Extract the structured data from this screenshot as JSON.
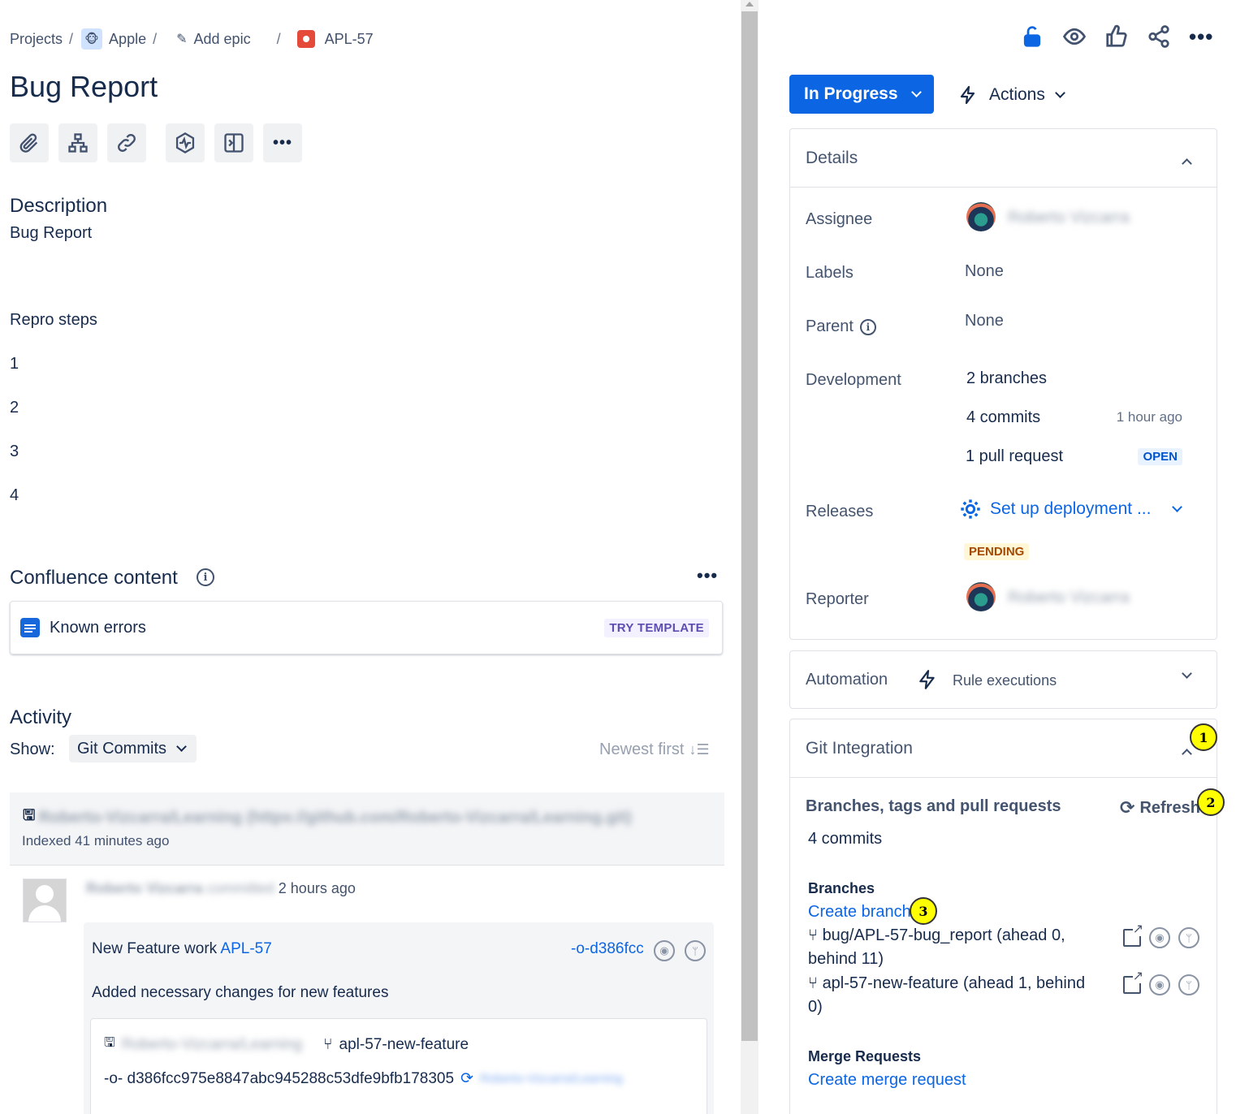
{
  "breadcrumb": {
    "projects": "Projects",
    "project": "Apple",
    "add_epic": "Add epic",
    "issue_key": "APL-57"
  },
  "issue": {
    "title": "Bug Report"
  },
  "toolbar": {
    "icons": [
      "attachment-icon",
      "child-issue-icon",
      "link-icon",
      "pulse-icon",
      "panel-icon",
      "more-icon"
    ],
    "more_label": "•••"
  },
  "description": {
    "heading": "Description",
    "text": "Bug Report",
    "repro_heading": "Repro steps",
    "steps": [
      "1",
      "2",
      "3",
      "4"
    ]
  },
  "confluence": {
    "heading": "Confluence content",
    "more_label": "•••",
    "card_label": "Known errors",
    "try_template": "TRY TEMPLATE"
  },
  "activity": {
    "heading": "Activity",
    "show_label": "Show:",
    "show_value": "Git Commits",
    "sort_label": "Newest first",
    "repo_name": "Roberto-Vizcarra/Learning (https://github.com/Roberto-Vizcarra/Learning.git)",
    "indexed": "Indexed 41 minutes ago",
    "commit": {
      "author": "Roberto Vizcarra",
      "committed_word": "committed",
      "time": "2 hours ago",
      "message_prefix": "New Feature work",
      "message_key": "APL-57",
      "short_hash": "-o-d386fcc",
      "body": "Added necessary changes for new features",
      "repo_short": "Roberto-Vizcarra/Learning",
      "branch": "apl-57-new-feature",
      "full_hash": "-o- d386fcc975e8847abc945288c53dfe9bfb178305",
      "hash_repo": "Roberto-Vizcarra/Learning"
    }
  },
  "header_actions": {
    "icons": [
      "lock-open-icon",
      "watch-icon",
      "like-icon",
      "share-icon",
      "more-icon"
    ],
    "more_label": "•••",
    "status": "In Progress",
    "actions": "Actions"
  },
  "details": {
    "heading": "Details",
    "assignee_label": "Assignee",
    "assignee_name": "Roberto Vizcarra",
    "labels_label": "Labels",
    "labels_value": "None",
    "parent_label": "Parent",
    "parent_value": "None",
    "development_label": "Development",
    "branches": "2 branches",
    "commits": "4 commits",
    "commits_time": "1 hour ago",
    "pull_request": "1 pull request",
    "pr_status": "OPEN",
    "releases_label": "Releases",
    "deployment": "Set up deployment ...",
    "deployment_status": "PENDING",
    "reporter_label": "Reporter",
    "reporter_name": "Roberto Vizcarra"
  },
  "automation": {
    "heading": "Automation",
    "rule_executions": "Rule executions"
  },
  "git": {
    "heading": "Git Integration",
    "section_title": "Branches, tags and pull requests",
    "refresh": "Refresh",
    "commits": "4 commits",
    "branches_heading": "Branches",
    "create_branch": "Create branch",
    "branches": [
      "bug/APL-57-bug_report (ahead 0, behind 11)",
      "apl-57-new-feature (ahead 1, behind 0)"
    ],
    "merge_heading": "Merge Requests",
    "create_merge": "Create merge request"
  },
  "annotations": [
    "1",
    "2",
    "3"
  ],
  "colors": {
    "primary": "#0c66e4",
    "bug": "#e5493a",
    "badge": "#ffff00",
    "pending_bg": "#fff7d6",
    "open_bg": "#e9f2ff"
  }
}
